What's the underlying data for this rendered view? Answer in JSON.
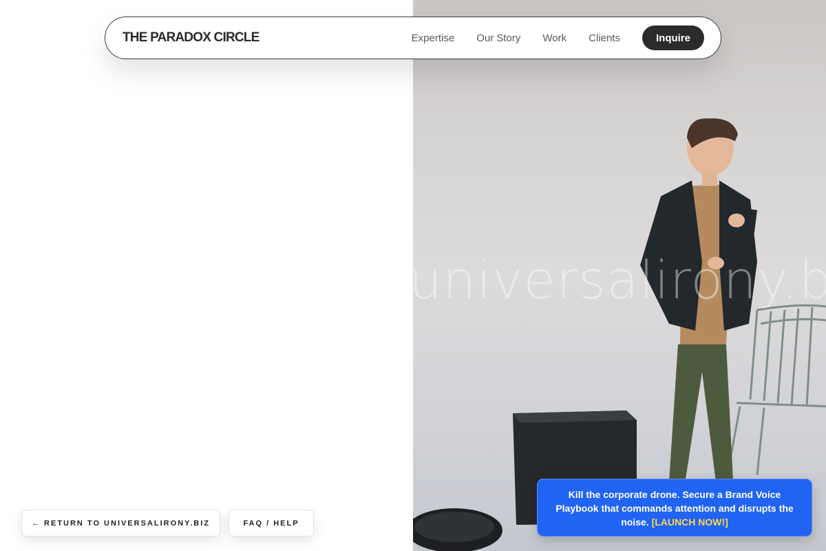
{
  "navbar": {
    "brand": "THE PARADOX CIRCLE",
    "links": [
      "Expertise",
      "Our Story",
      "Work",
      "Clients"
    ],
    "cta_label": "Inquire"
  },
  "hero": {
    "watermark": "universalirony.biz"
  },
  "footer_buttons": {
    "return_label": "← RETURN TO UNIVERSALIRONY.BIZ",
    "faq_label": "FAQ / HELP"
  },
  "promo": {
    "text": "Kill the corporate drone. Secure a Brand Voice Playbook that commands attention and disrupts the noise.",
    "link_label": "[LAUNCH NOW!]"
  },
  "colors": {
    "promo_bg": "#2164f3",
    "promo_link": "#ffd84a",
    "cta_bg": "#2b2b2b"
  }
}
